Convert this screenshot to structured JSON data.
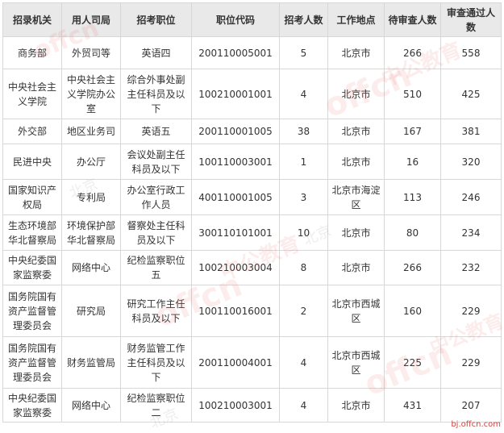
{
  "table": {
    "headers": [
      "招录机关",
      "用人司局",
      "招考职位",
      "职位代码",
      "招考人数",
      "工作地点",
      "待审查人数",
      "审查通过人数"
    ],
    "rows": [
      [
        "商务部",
        "外贸司等",
        "英语四",
        "200110005001",
        "5",
        "北京市",
        "266",
        "558"
      ],
      [
        "中央社会主义学院",
        "中央社会主义学院办公室",
        "综合外事处副主任科员及以下",
        "100210001001",
        "4",
        "北京市",
        "510",
        "425"
      ],
      [
        "外交部",
        "地区业务司",
        "英语五",
        "200110001005",
        "38",
        "北京市",
        "167",
        "381"
      ],
      [
        "民进中央",
        "办公厅",
        "会议处副主任科员及以下",
        "100110003001",
        "1",
        "北京市",
        "16",
        "320"
      ],
      [
        "国家知识产权局",
        "专利局",
        "办公室行政工作人员",
        "400110001005",
        "3",
        "北京市海淀区",
        "113",
        "246"
      ],
      [
        "生态环境部华北督察局",
        "环境保护部华北督察局",
        "督察处主任科员及以下",
        "300110101001",
        "10",
        "北京市",
        "80",
        "234"
      ],
      [
        "中央纪委国家监察委",
        "网络中心",
        "纪检监察职位五",
        "100210003004",
        "8",
        "北京市",
        "266",
        "232"
      ],
      [
        "国务院国有资产监督管理委员会",
        "研究局",
        "研究工作主任科员及以下",
        "100110016001",
        "2",
        "北京市西城区",
        "160",
        "229"
      ],
      [
        "国务院国有资产监督管理委员会",
        "财务监管局",
        "财务监管工作主任科员及以下",
        "200110004001",
        "4",
        "北京市西城区",
        "225",
        "229"
      ],
      [
        "中央纪委国家监察委",
        "网络中心",
        "纪检监察职位二",
        "100210003001",
        "4",
        "北京市",
        "431",
        "207"
      ]
    ]
  },
  "watermark": {
    "logo": "offcn",
    "brand": "中公教育",
    "city": "北京",
    "site": "bj.offcn.com"
  }
}
